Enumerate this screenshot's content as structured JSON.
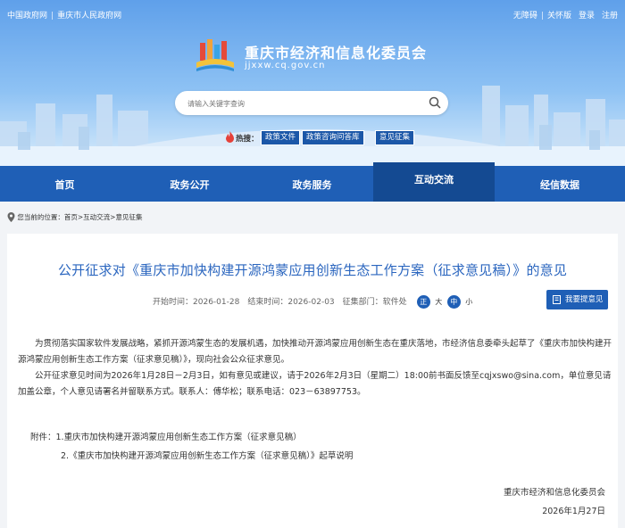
{
  "topbar": {
    "left_links": [
      "中国政府网",
      "重庆市人民政府网"
    ],
    "right_links": [
      "无障碍",
      "关怀版",
      "登录",
      "注册"
    ]
  },
  "brand": {
    "name": "重庆市经济和信息化委员会",
    "domain": "jjxxw.cq.gov.cn"
  },
  "search": {
    "placeholder": "请输入关键字查询"
  },
  "hotwords": {
    "label": "热搜：",
    "tags": [
      "政策文件",
      "政策咨询问答库",
      "意见征集"
    ]
  },
  "nav": {
    "items": [
      "首页",
      "政务公开",
      "政务服务",
      "互动交流",
      "经信数据"
    ],
    "active": "互动交流"
  },
  "breadcrumb": {
    "prefix": "您当前的位置：",
    "path": "首页>互动交流>意见征集"
  },
  "article": {
    "title": "公开征求对《重庆市加快构建开源鸿蒙应用创新生态工作方案（征求意见稿）》的意见",
    "meta": {
      "start_label": "开始时间：",
      "start_value": "2026-01-28",
      "end_label": "结束时间：",
      "end_value": "2026-02-03",
      "unit_label": "征集部门：",
      "unit_value": "软件处",
      "font_sizes": [
        "正",
        "大",
        "中",
        "小"
      ],
      "font_selected": "中"
    },
    "opinion_button": "我要提意见",
    "paragraphs": [
      "为贯彻落实国家软件发展战略，紧抓开源鸿蒙生态的发展机遇，加快推动开源鸿蒙应用创新生态在重庆落地，市经济信息委牵头起草了《重庆市加快构建开源鸿蒙应用创新生态工作方案（征求意见稿）》，现向社会公众征求意见。",
      "公开征求意见时间为2026年1月28日－2月3日，如有意见或建议，请于2026年2月3日（星期二）18:00前书面反馈至cqjxswo@sina.com，单位意见请加盖公章，个人意见请署名并留联系方式。联系人：傅华松；联系电话：023－63897753。"
    ],
    "attachments": {
      "label": "附件：",
      "items": [
        "1.重庆市加快构建开源鸿蒙应用创新生态工作方案（征求意见稿）",
        "2.《重庆市加快构建开源鸿蒙应用创新生态工作方案（征求意见稿）》起草说明"
      ]
    },
    "signature": {
      "org": "重庆市经济和信息化委员会",
      "date": "2026年1月27日"
    }
  },
  "colors": {
    "nav_bg": "#1f5fb6",
    "nav_active": "#144a92",
    "title": "#2b66bf",
    "page_bg": "#f2f4f7"
  }
}
